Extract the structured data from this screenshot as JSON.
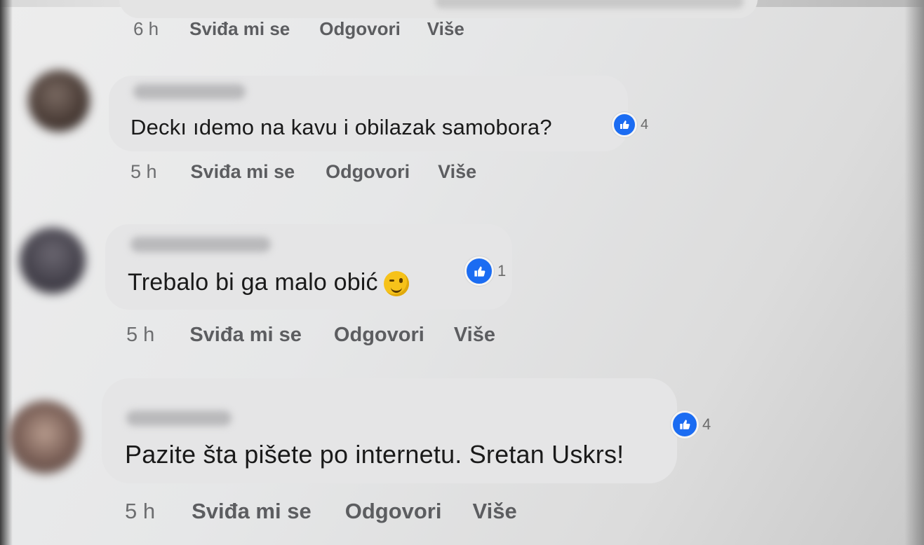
{
  "previous_comment": {
    "time": "6 h",
    "actions": [
      "Sviđa mi se",
      "Odgovori",
      "Više"
    ]
  },
  "comments": [
    {
      "text": "Deckı ıdemo na kavu i obilazak samobora?",
      "likes": "4",
      "time": "5 h",
      "actions": [
        "Sviđa mi se",
        "Odgovori",
        "Više"
      ]
    },
    {
      "text": "Trebalo bi ga malo obić",
      "emoji": "winking-face-emoji",
      "likes": "1",
      "time": "5 h",
      "actions": [
        "Sviđa mi se",
        "Odgovori",
        "Više"
      ]
    },
    {
      "text": "Pazite šta pišete po internetu. Sretan Uskrs!",
      "likes": "4",
      "time": "5 h",
      "actions": [
        "Sviđa mi se",
        "Odgovori",
        "Više"
      ]
    }
  ],
  "colors": {
    "like_badge": "#1b6cf2",
    "bubble": "#e5e5e6",
    "action_text": "#5c5d60",
    "comment_text": "#1a1a1a"
  },
  "icons": {
    "like": "thumbs-up-icon",
    "avatar": "blurred-avatar"
  }
}
